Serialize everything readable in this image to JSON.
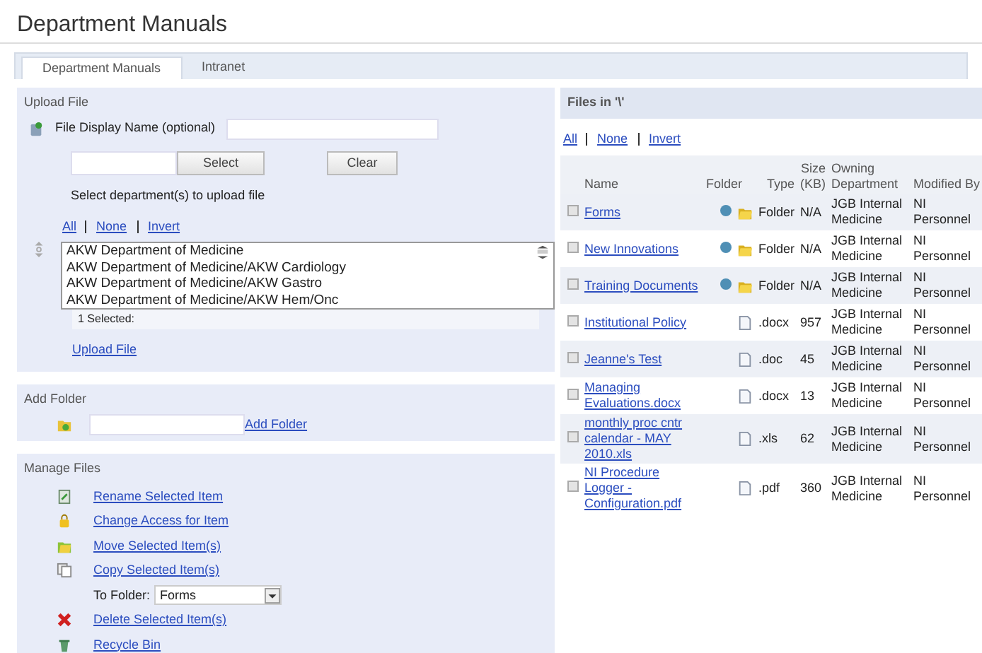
{
  "window": {
    "title": "Department Manuals"
  },
  "tabs": [
    {
      "label": "Department Manuals",
      "selected": true
    },
    {
      "label": "Intranet",
      "selected": false
    }
  ],
  "upload": {
    "heading": "Upload File",
    "name_label": "File Display Name (optional)",
    "select_button": "Select",
    "clear_button": "Clear",
    "dept_prompt": "Select department(s) to upload file",
    "select_links": [
      "All",
      "None",
      "Invert"
    ],
    "departments": [
      "AKW Department of Medicine",
      "AKW Department of Medicine/AKW Cardiology",
      "AKW Department of Medicine/AKW Gastro",
      "AKW Department of Medicine/AKW Hem/Onc"
    ],
    "selected_count": "1 Selected:",
    "upload_link": "Upload File"
  },
  "add_folder": {
    "heading": "Add Folder",
    "link": "Add Folder"
  },
  "manage": {
    "heading": "Manage Files",
    "actions": [
      {
        "kind": "rename",
        "label": "Rename Selected Item"
      },
      {
        "kind": "access",
        "label": "Change Access for Item"
      },
      {
        "kind": "move",
        "label": "Move Selected Item(s)"
      },
      {
        "kind": "copy",
        "label": "Copy Selected Item(s)"
      },
      {
        "kind": "folder_select",
        "label": "To Folder:",
        "value": "Forms"
      },
      {
        "kind": "delete",
        "label": "Delete Selected Item(s)"
      },
      {
        "kind": "recycle",
        "label": "Recycle Bin"
      }
    ]
  },
  "files": {
    "heading": "Files in '\\'",
    "select_links": [
      "All",
      "None",
      "Invert"
    ],
    "columns": [
      "Name",
      "Folder",
      "Type",
      "Size (KB)",
      "Owning Department",
      "Modified By"
    ],
    "rows": [
      {
        "kind": "folder",
        "checked": false,
        "name": "Forms",
        "type": "Folder",
        "size": "N/A",
        "department": "JGB Internal Medicine",
        "modified_by": "NI Personnel"
      },
      {
        "kind": "folder",
        "checked": false,
        "name": "New Innovations",
        "type": "Folder",
        "size": "N/A",
        "department": "JGB Internal Medicine",
        "modified_by": "NI Personnel"
      },
      {
        "kind": "folder",
        "checked": false,
        "name": "Training Documents",
        "type": "Folder",
        "size": "N/A",
        "department": "JGB Internal Medicine",
        "modified_by": "NI Personnel"
      },
      {
        "kind": "file",
        "checked": false,
        "name": "Institutional Policy",
        "type": ".docx",
        "size": "957",
        "department": "JGB Internal Medicine",
        "modified_by": "NI Personnel"
      },
      {
        "kind": "file",
        "checked": false,
        "name": "Jeanne's Test",
        "type": ".doc",
        "size": "45",
        "department": "JGB Internal Medicine",
        "modified_by": "NI Personnel"
      },
      {
        "kind": "file",
        "checked": false,
        "name": "Managing Evaluations.docx",
        "type": ".docx",
        "size": "13",
        "department": "JGB Internal Medicine",
        "modified_by": "NI Personnel"
      },
      {
        "kind": "file",
        "checked": false,
        "name": "monthly proc cntr calendar - MAY 2010.xls",
        "type": ".xls",
        "size": "62",
        "department": "JGB Internal Medicine",
        "modified_by": "NI Personnel"
      },
      {
        "kind": "file",
        "checked": false,
        "name": "NI Procedure Logger - Configuration.pdf",
        "type": ".pdf",
        "size": "360",
        "department": "JGB Internal Medicine",
        "modified_by": "NI Personnel"
      }
    ]
  }
}
